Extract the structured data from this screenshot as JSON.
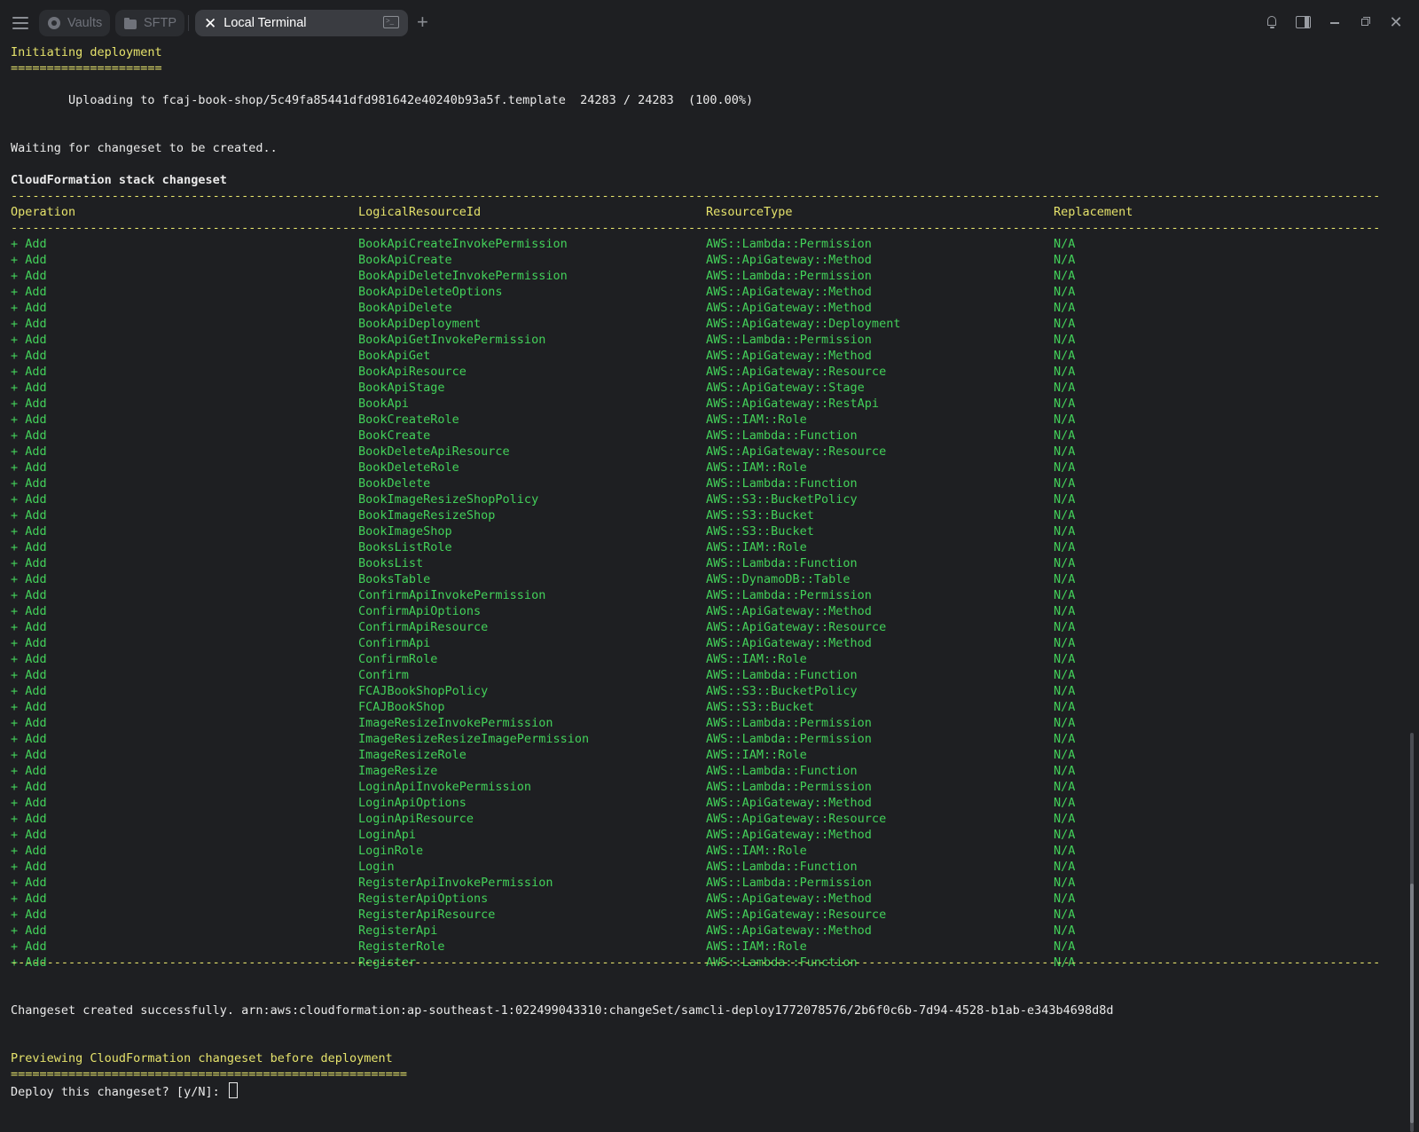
{
  "tabs": {
    "vaults": "Vaults",
    "sftp": "SFTP",
    "local_terminal": "Local Terminal"
  },
  "terminal": {
    "initiating": "Initiating deployment",
    "initiating_rule": "=====================",
    "uploading": "        Uploading to fcaj-book-shop/5c49fa85441dfd981642e40240b93a5f.template  24283 / 24283  (100.00%)",
    "waiting": "Waiting for changeset to be created..",
    "changeset_title": "CloudFormation stack changeset",
    "rule": "-----------------------------------------------------------------------------------------------------------------------------------------------------------------------------------------------------------------------------",
    "headers": {
      "operation": "Operation",
      "logical": "LogicalResourceId",
      "type": "ResourceType",
      "replacement": "Replacement"
    },
    "rows": [
      [
        "+ Add",
        "BookApiCreateInvokePermission",
        "AWS::Lambda::Permission",
        "N/A"
      ],
      [
        "+ Add",
        "BookApiCreate",
        "AWS::ApiGateway::Method",
        "N/A"
      ],
      [
        "+ Add",
        "BookApiDeleteInvokePermission",
        "AWS::Lambda::Permission",
        "N/A"
      ],
      [
        "+ Add",
        "BookApiDeleteOptions",
        "AWS::ApiGateway::Method",
        "N/A"
      ],
      [
        "+ Add",
        "BookApiDelete",
        "AWS::ApiGateway::Method",
        "N/A"
      ],
      [
        "+ Add",
        "BookApiDeployment",
        "AWS::ApiGateway::Deployment",
        "N/A"
      ],
      [
        "+ Add",
        "BookApiGetInvokePermission",
        "AWS::Lambda::Permission",
        "N/A"
      ],
      [
        "+ Add",
        "BookApiGet",
        "AWS::ApiGateway::Method",
        "N/A"
      ],
      [
        "+ Add",
        "BookApiResource",
        "AWS::ApiGateway::Resource",
        "N/A"
      ],
      [
        "+ Add",
        "BookApiStage",
        "AWS::ApiGateway::Stage",
        "N/A"
      ],
      [
        "+ Add",
        "BookApi",
        "AWS::ApiGateway::RestApi",
        "N/A"
      ],
      [
        "+ Add",
        "BookCreateRole",
        "AWS::IAM::Role",
        "N/A"
      ],
      [
        "+ Add",
        "BookCreate",
        "AWS::Lambda::Function",
        "N/A"
      ],
      [
        "+ Add",
        "BookDeleteApiResource",
        "AWS::ApiGateway::Resource",
        "N/A"
      ],
      [
        "+ Add",
        "BookDeleteRole",
        "AWS::IAM::Role",
        "N/A"
      ],
      [
        "+ Add",
        "BookDelete",
        "AWS::Lambda::Function",
        "N/A"
      ],
      [
        "+ Add",
        "BookImageResizeShopPolicy",
        "AWS::S3::BucketPolicy",
        "N/A"
      ],
      [
        "+ Add",
        "BookImageResizeShop",
        "AWS::S3::Bucket",
        "N/A"
      ],
      [
        "+ Add",
        "BookImageShop",
        "AWS::S3::Bucket",
        "N/A"
      ],
      [
        "+ Add",
        "BooksListRole",
        "AWS::IAM::Role",
        "N/A"
      ],
      [
        "+ Add",
        "BooksList",
        "AWS::Lambda::Function",
        "N/A"
      ],
      [
        "+ Add",
        "BooksTable",
        "AWS::DynamoDB::Table",
        "N/A"
      ],
      [
        "+ Add",
        "ConfirmApiInvokePermission",
        "AWS::Lambda::Permission",
        "N/A"
      ],
      [
        "+ Add",
        "ConfirmApiOptions",
        "AWS::ApiGateway::Method",
        "N/A"
      ],
      [
        "+ Add",
        "ConfirmApiResource",
        "AWS::ApiGateway::Resource",
        "N/A"
      ],
      [
        "+ Add",
        "ConfirmApi",
        "AWS::ApiGateway::Method",
        "N/A"
      ],
      [
        "+ Add",
        "ConfirmRole",
        "AWS::IAM::Role",
        "N/A"
      ],
      [
        "+ Add",
        "Confirm",
        "AWS::Lambda::Function",
        "N/A"
      ],
      [
        "+ Add",
        "FCAJBookShopPolicy",
        "AWS::S3::BucketPolicy",
        "N/A"
      ],
      [
        "+ Add",
        "FCAJBookShop",
        "AWS::S3::Bucket",
        "N/A"
      ],
      [
        "+ Add",
        "ImageResizeInvokePermission",
        "AWS::Lambda::Permission",
        "N/A"
      ],
      [
        "+ Add",
        "ImageResizeResizeImagePermission",
        "AWS::Lambda::Permission",
        "N/A"
      ],
      [
        "+ Add",
        "ImageResizeRole",
        "AWS::IAM::Role",
        "N/A"
      ],
      [
        "+ Add",
        "ImageResize",
        "AWS::Lambda::Function",
        "N/A"
      ],
      [
        "+ Add",
        "LoginApiInvokePermission",
        "AWS::Lambda::Permission",
        "N/A"
      ],
      [
        "+ Add",
        "LoginApiOptions",
        "AWS::ApiGateway::Method",
        "N/A"
      ],
      [
        "+ Add",
        "LoginApiResource",
        "AWS::ApiGateway::Resource",
        "N/A"
      ],
      [
        "+ Add",
        "LoginApi",
        "AWS::ApiGateway::Method",
        "N/A"
      ],
      [
        "+ Add",
        "LoginRole",
        "AWS::IAM::Role",
        "N/A"
      ],
      [
        "+ Add",
        "Login",
        "AWS::Lambda::Function",
        "N/A"
      ],
      [
        "+ Add",
        "RegisterApiInvokePermission",
        "AWS::Lambda::Permission",
        "N/A"
      ],
      [
        "+ Add",
        "RegisterApiOptions",
        "AWS::ApiGateway::Method",
        "N/A"
      ],
      [
        "+ Add",
        "RegisterApiResource",
        "AWS::ApiGateway::Resource",
        "N/A"
      ],
      [
        "+ Add",
        "RegisterApi",
        "AWS::ApiGateway::Method",
        "N/A"
      ],
      [
        "+ Add",
        "RegisterRole",
        "AWS::IAM::Role",
        "N/A"
      ],
      [
        "+ Add",
        "Register",
        "AWS::Lambda::Function",
        "N/A"
      ]
    ],
    "created": "Changeset created successfully. arn:aws:cloudformation:ap-southeast-1:022499043310:changeSet/samcli-deploy1772078576/2b6f0c6b-7d94-4528-b1ab-e343b4698d8d",
    "previewing": "Previewing CloudFormation changeset before deployment",
    "previewing_rule": "=======================================================",
    "prompt": "Deploy this changeset? [y/N]: "
  }
}
